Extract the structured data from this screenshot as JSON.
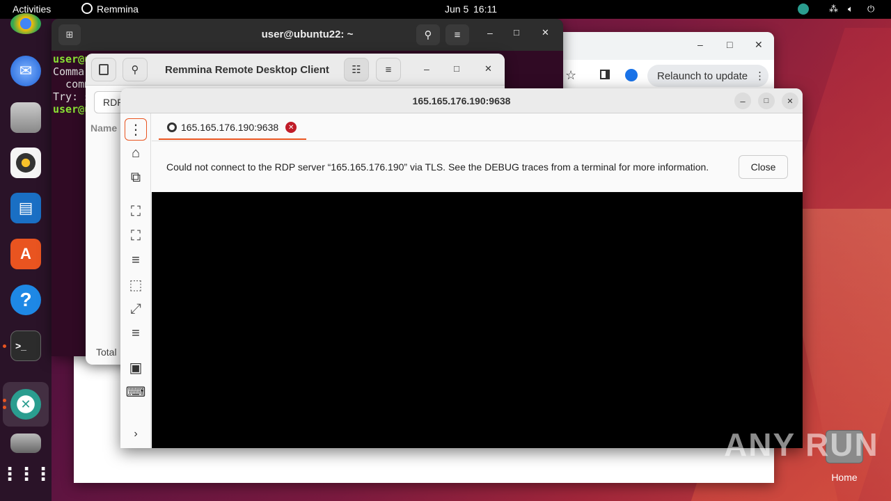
{
  "topbar": {
    "activities": "Activities",
    "app_name": "Remmina",
    "date": "Jun 5",
    "time": "16:11"
  },
  "terminal": {
    "title": "user@ubuntu22: ~",
    "lines": [
      "user@u",
      "Comma",
      "  comm",
      "Try: s",
      "user@u"
    ]
  },
  "chrome": {
    "relaunch": "Relaunch to update"
  },
  "remmina_main": {
    "title": "Remmina Remote Desktop Client",
    "protocol": "RDP",
    "name_col": "Name",
    "total": "Total"
  },
  "rdp_window": {
    "title": "165.165.176.190:9638",
    "tab_label": "165.165.176.190:9638",
    "error_message": "Could not connect to the RDP server “165.165.176.190” via TLS. See the DEBUG traces from a terminal for more information.",
    "close_label": "Close"
  },
  "desktop": {
    "home_label": "Home",
    "watermark": "ANY RUN"
  },
  "colors": {
    "accent": "#e95420",
    "error": "#c01c28"
  }
}
